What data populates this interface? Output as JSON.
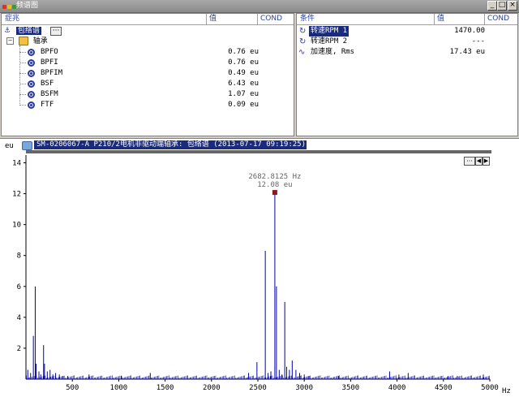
{
  "window": {
    "title": "频谱图"
  },
  "left_panel": {
    "headers": {
      "symptom": "症兆",
      "value": "值",
      "cond": "COND"
    },
    "root": {
      "label": "包络谱",
      "more_label": "···"
    },
    "group": {
      "label": "轴承"
    },
    "items": [
      {
        "label": "BPFO",
        "value": "0.76 eu"
      },
      {
        "label": "BPFI",
        "value": "0.76 eu"
      },
      {
        "label": "BPFIM",
        "value": "0.49 eu"
      },
      {
        "label": "BSF",
        "value": "6.43 eu"
      },
      {
        "label": "BSFM",
        "value": "1.07 eu"
      },
      {
        "label": "FTF",
        "value": "0.09 eu"
      }
    ]
  },
  "right_panel": {
    "headers": {
      "condition": "条件",
      "value": "值",
      "cond": "COND"
    },
    "rows": [
      {
        "icon": "refresh-icon",
        "label": "转速RPM 1",
        "value": "1470.00",
        "selected": true
      },
      {
        "icon": "refresh-icon",
        "label": "转速RPM 2",
        "value": "---"
      },
      {
        "icon": "waveform-icon",
        "label": "加速度, Rms",
        "value": "17.43 eu"
      }
    ]
  },
  "chart_header": {
    "label": "SM-0206067-A  P210/2电机非驱动端轴承: 包络谱 (2013-07-17 09:19:25)",
    "controls": [
      "···",
      "◀",
      "▶"
    ]
  },
  "cursor": {
    "freq_label": "2682.8125 Hz",
    "amp_label": "12.08 eu",
    "marker_color": "#8b1a1a"
  },
  "chart_data": {
    "type": "line",
    "ylabel": "eu",
    "xlabel": "Hz",
    "xlim": [
      0,
      5000
    ],
    "ylim": [
      0,
      14.5
    ],
    "yticks": [
      2,
      4,
      6,
      8,
      10,
      12,
      14
    ],
    "xticks": [
      500,
      1000,
      1500,
      2000,
      2500,
      3000,
      3500,
      4000,
      4500,
      5000
    ],
    "color": "#0000aa",
    "peaks": [
      [
        20,
        0.6
      ],
      [
        50,
        0.4
      ],
      [
        80,
        2.8
      ],
      [
        100,
        6.0
      ],
      [
        110,
        1.0
      ],
      [
        140,
        0.5
      ],
      [
        160,
        0.3
      ],
      [
        190,
        2.2
      ],
      [
        200,
        1.0
      ],
      [
        230,
        0.5
      ],
      [
        260,
        0.6
      ],
      [
        290,
        0.3
      ],
      [
        320,
        0.4
      ],
      [
        360,
        0.3
      ],
      [
        400,
        0.2
      ],
      [
        450,
        0.2
      ],
      [
        680,
        0.3
      ],
      [
        1030,
        0.2
      ],
      [
        1340,
        0.4
      ],
      [
        2400,
        0.4
      ],
      [
        2490,
        1.1
      ],
      [
        2580,
        8.3
      ],
      [
        2610,
        0.4
      ],
      [
        2640,
        0.5
      ],
      [
        2682.8,
        12.08
      ],
      [
        2700,
        6.0
      ],
      [
        2730,
        0.6
      ],
      [
        2760,
        0.3
      ],
      [
        2790,
        5.0
      ],
      [
        2810,
        0.8
      ],
      [
        2840,
        0.6
      ],
      [
        2870,
        1.2
      ],
      [
        2910,
        0.6
      ],
      [
        2950,
        0.4
      ],
      [
        3000,
        0.3
      ],
      [
        3050,
        0.2
      ],
      [
        3370,
        0.2
      ],
      [
        3920,
        0.5
      ],
      [
        4020,
        0.3
      ],
      [
        4120,
        0.4
      ],
      [
        4550,
        0.2
      ],
      [
        4650,
        0.2
      ],
      [
        4930,
        0.3
      ]
    ]
  }
}
